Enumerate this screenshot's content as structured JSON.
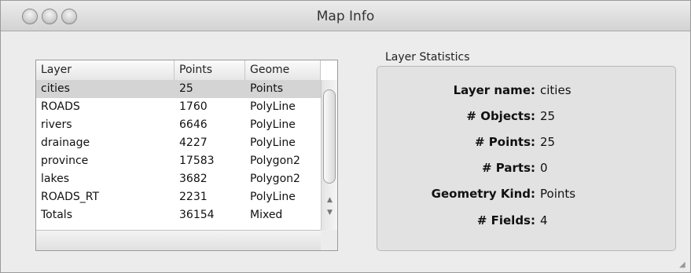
{
  "window": {
    "title": "Map Info"
  },
  "layer_table": {
    "columns": [
      "Layer",
      "Points",
      "Geome"
    ],
    "rows": [
      {
        "layer": "cities",
        "points": "25",
        "geometry": "Points"
      },
      {
        "layer": "ROADS",
        "points": "1760",
        "geometry": "PolyLine"
      },
      {
        "layer": "rivers",
        "points": "6646",
        "geometry": "PolyLine"
      },
      {
        "layer": "drainage",
        "points": "4227",
        "geometry": "PolyLine"
      },
      {
        "layer": "province",
        "points": "17583",
        "geometry": "Polygon2"
      },
      {
        "layer": "lakes",
        "points": "3682",
        "geometry": "Polygon2"
      },
      {
        "layer": "ROADS_RT",
        "points": "2231",
        "geometry": "PolyLine"
      },
      {
        "layer": "Totals",
        "points": "36154",
        "geometry": "Mixed"
      }
    ],
    "selected_index": 0
  },
  "stats": {
    "group_label": "Layer Statistics",
    "items": [
      {
        "key": "Layer name:",
        "value": "cities"
      },
      {
        "key": "# Objects:",
        "value": "25"
      },
      {
        "key": "# Points:",
        "value": "25"
      },
      {
        "key": "# Parts:",
        "value": "0"
      },
      {
        "key": "Geometry Kind:",
        "value": "Points"
      },
      {
        "key": "# Fields:",
        "value": "4"
      }
    ]
  }
}
